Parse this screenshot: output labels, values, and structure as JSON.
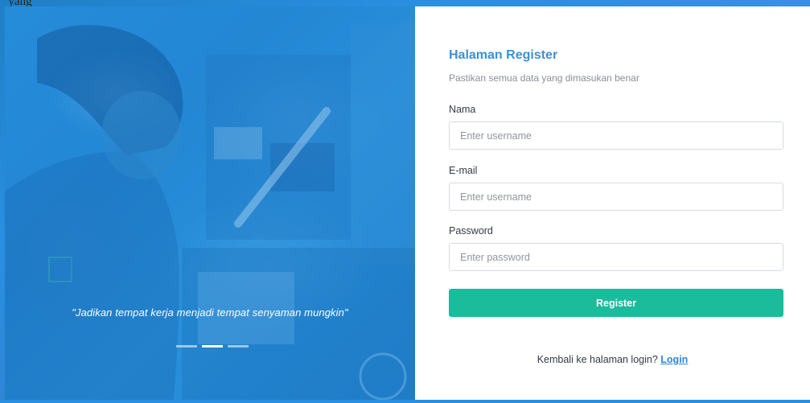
{
  "top_text_fragment": "a yang",
  "hero": {
    "quote": "\"Jadikan tempat kerja menjadi tempat senyaman mungkin\"",
    "carousel": {
      "count": 3,
      "active_index": 1
    }
  },
  "form": {
    "title": "Halaman Register",
    "subtitle": "Pastikan semua data yang dimasukan benar",
    "fields": [
      {
        "label": "Nama",
        "placeholder": "Enter username",
        "value": ""
      },
      {
        "label": "E-mail",
        "placeholder": "Enter username",
        "value": ""
      },
      {
        "label": "Password",
        "placeholder": "Enter password",
        "value": ""
      }
    ],
    "register_label": "Register",
    "login_prompt": "Kembali ke halaman login?",
    "login_link_label": "Login"
  },
  "colors": {
    "accent_blue": "#3f8fd2",
    "button_green": "#1abc9c",
    "link_blue": "#2f86d6",
    "hero_blue": "#2b8ad6"
  }
}
